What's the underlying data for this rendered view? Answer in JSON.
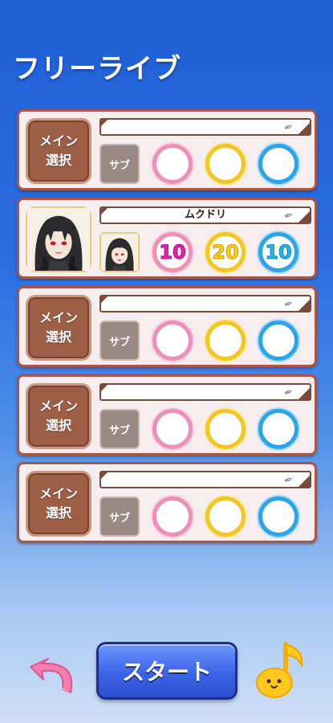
{
  "screen": {
    "title": "フリーライブ"
  },
  "slots": [
    {
      "main_label_1": "メイン",
      "main_label_2": "選択",
      "name": "",
      "sub_label": "サブ",
      "filled": false,
      "stats": [
        "",
        "",
        ""
      ]
    },
    {
      "main_label_1": "",
      "main_label_2": "",
      "name": "ムクドリ",
      "sub_label": "",
      "filled": true,
      "portrait": "girl-portrait",
      "stats": [
        "10",
        "20",
        "10"
      ]
    },
    {
      "main_label_1": "メイン",
      "main_label_2": "選択",
      "name": "",
      "sub_label": "サブ",
      "filled": false,
      "stats": [
        "",
        "",
        ""
      ]
    },
    {
      "main_label_1": "メイン",
      "main_label_2": "選択",
      "name": "",
      "sub_label": "サブ",
      "filled": false,
      "stats": [
        "",
        "",
        ""
      ]
    },
    {
      "main_label_1": "メイン",
      "main_label_2": "選択",
      "name": "",
      "sub_label": "サブ",
      "filled": false,
      "stats": [
        "",
        "",
        ""
      ]
    }
  ],
  "buttons": {
    "back_icon": "undo-arrow-icon",
    "start_label": "スタート",
    "music_icon": "music-note-icon"
  },
  "colors": {
    "stat_pink": "#e820b0",
    "stat_yellow": "#ffce1a",
    "stat_blue": "#1fb6e8",
    "panel_border": "#a6574a"
  }
}
